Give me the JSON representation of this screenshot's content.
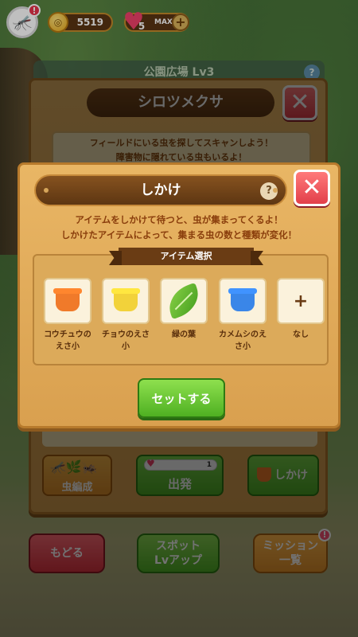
{
  "topbar": {
    "avatar_alert": "!",
    "coins": "5519",
    "hearts": "5",
    "hearts_status": "MAX",
    "plus": "+"
  },
  "back_panel": {
    "title": "公園広場 Lv3",
    "help": "?"
  },
  "spot_panel": {
    "title": "シロツメクサ",
    "close": "✕",
    "info_line1": "フィールドにいる虫を探してスキャンしよう！",
    "info_line2": "障害物に隠れている虫もいるよ！",
    "insect_button": "虫編成",
    "start_button": "出発",
    "start_cost": "1",
    "trap_button": "しかけ"
  },
  "bottom_buttons": {
    "back": "もどる",
    "spot_lvup": "スポット\nLvアップ",
    "mission": "ミッション\n一覧",
    "mission_alert": "!"
  },
  "modal": {
    "title": "しかけ",
    "help": "?",
    "close": "✕",
    "desc_line1": "アイテムをしかけて待つと、虫が集まってくるよ！",
    "desc_line2": "しかけたアイテムによって、集まる虫の数と種類が変化！",
    "select_header": "アイテム選択",
    "items": [
      {
        "label": "コウチュウのえさ小",
        "icon": "orange-cup-icon"
      },
      {
        "label": "チョウのえさ小",
        "icon": "yellow-cup-icon"
      },
      {
        "label": "緑の葉",
        "icon": "leaf-icon"
      },
      {
        "label": "カメムシのえさ小",
        "icon": "blue-cup-icon"
      },
      {
        "label": "なし",
        "icon": "plus-icon"
      }
    ],
    "set_button": "セットする"
  },
  "colors": {
    "wood": "#e9b665",
    "title_brown": "#5d3612",
    "accent_green": "#4fb022",
    "close_red": "#e23f4a"
  }
}
